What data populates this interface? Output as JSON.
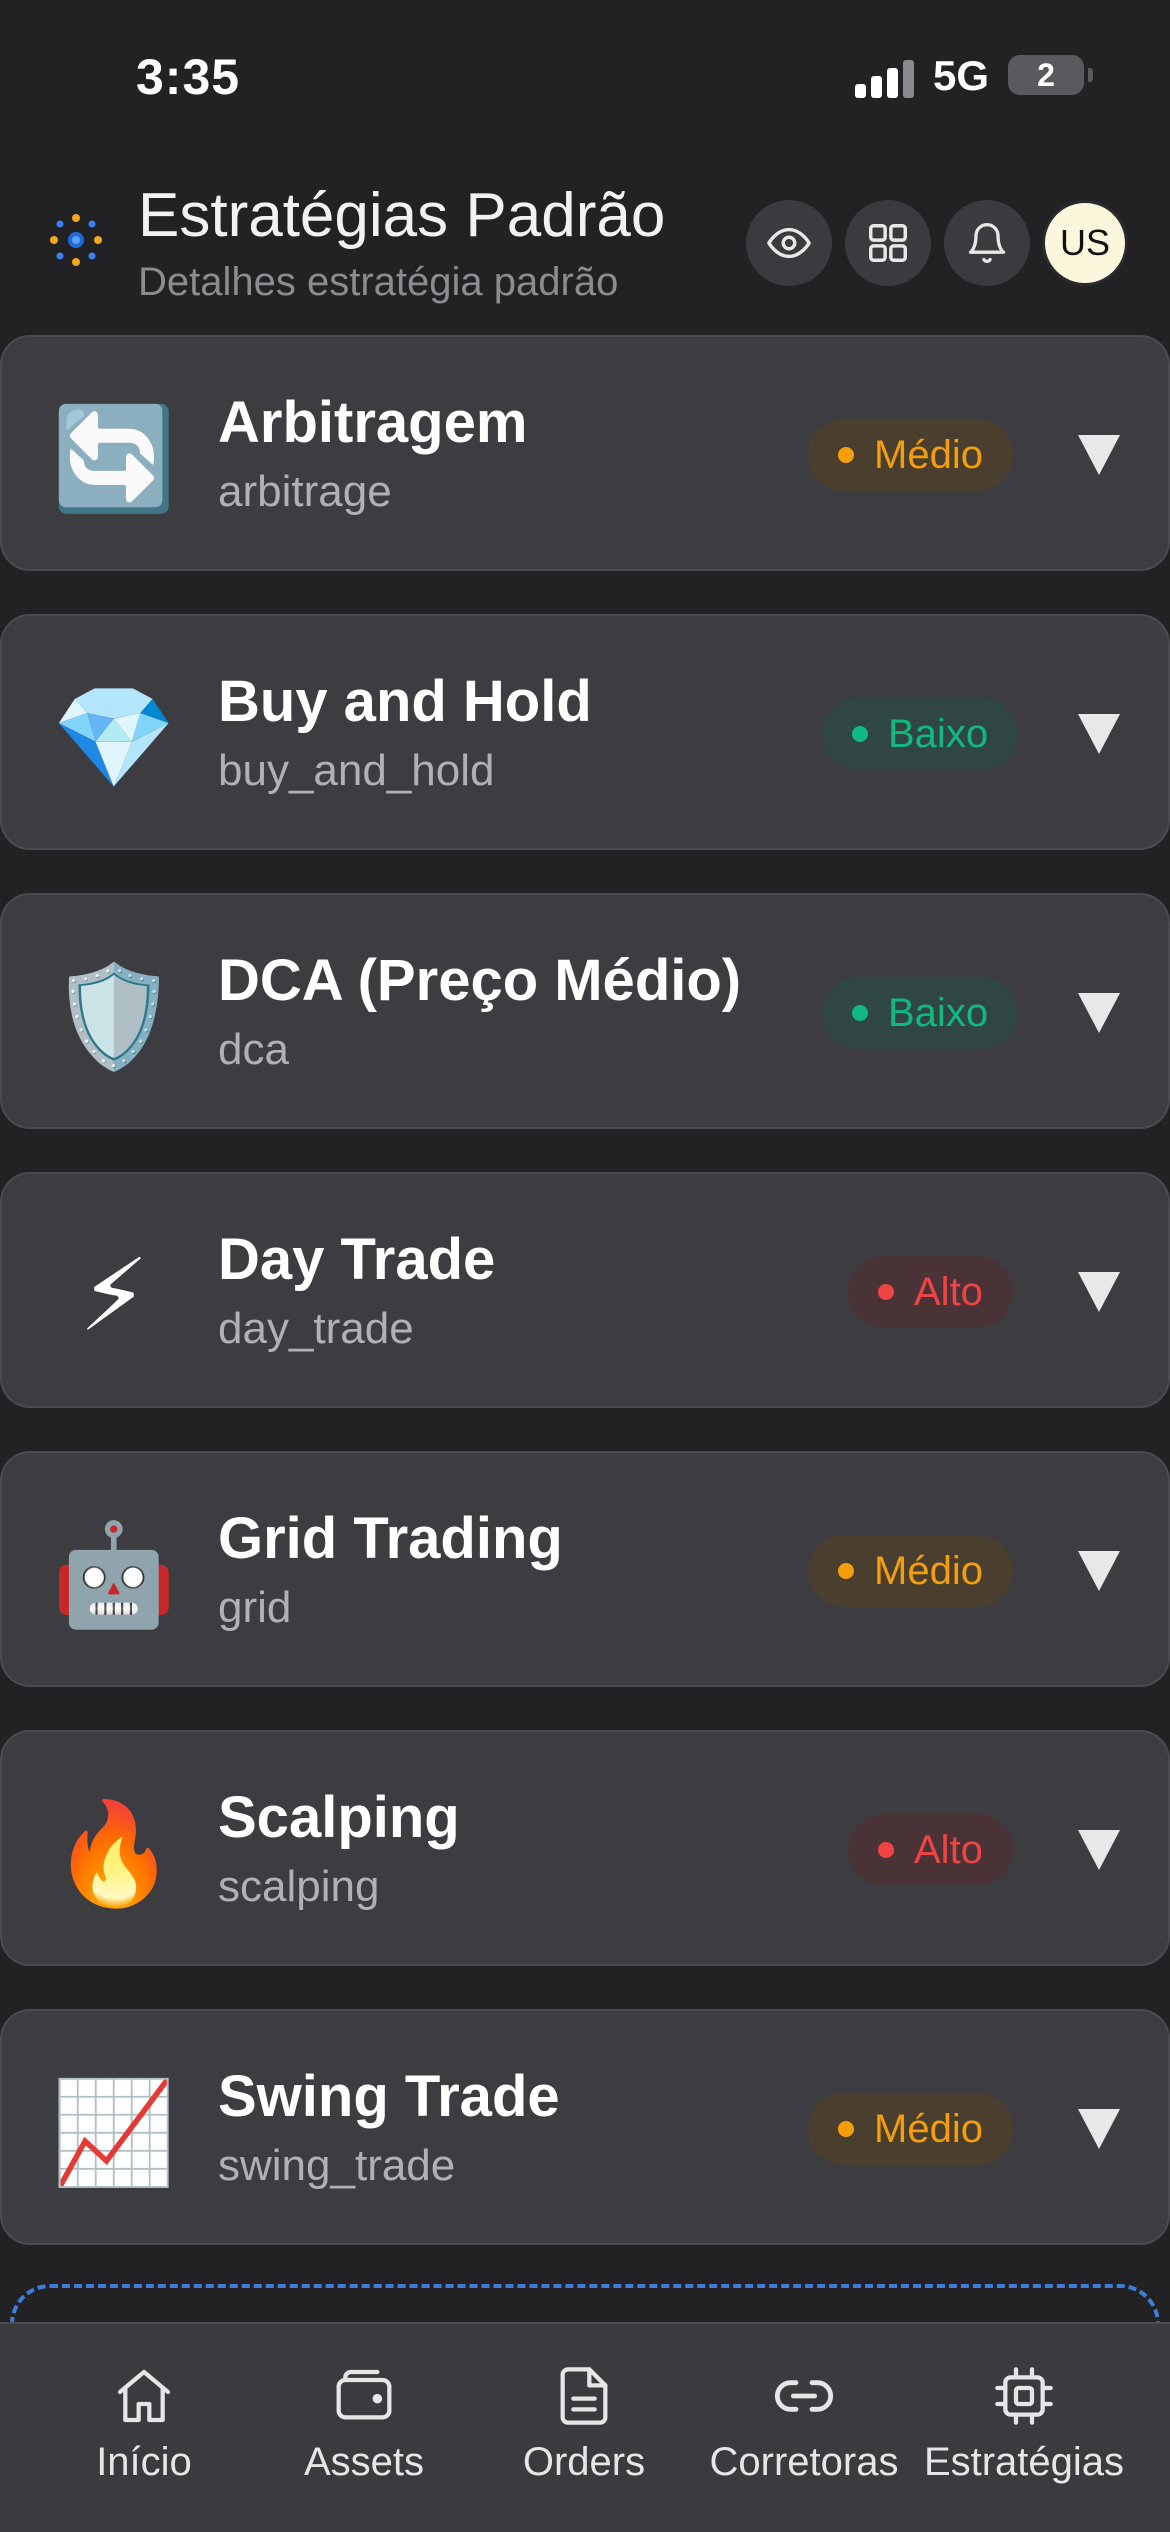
{
  "status_bar": {
    "time": "3:35",
    "network": "5G",
    "battery": "2"
  },
  "header": {
    "title": "Estratégias Padrão",
    "subtitle": "Detalhes estratégia padrão",
    "avatar_initials": "US",
    "icons": [
      "eye-icon",
      "grid-icon",
      "bell-icon"
    ]
  },
  "colors": {
    "medium": "#f59e0b",
    "low": "#10b981",
    "high": "#ef4444",
    "accent": "#3b7dd8"
  },
  "strategies": [
    {
      "name": "Arbitragem",
      "key": "arbitrage",
      "risk": "Médio",
      "risk_level": "medium",
      "emoji": "🔄"
    },
    {
      "name": "Buy and Hold",
      "key": "buy_and_hold",
      "risk": "Baixo",
      "risk_level": "low",
      "emoji": "💎"
    },
    {
      "name": "DCA (Preço Médio)",
      "key": "dca",
      "risk": "Baixo",
      "risk_level": "low",
      "emoji": "🛡️"
    },
    {
      "name": "Day Trade",
      "key": "day_trade",
      "risk": "Alto",
      "risk_level": "high",
      "emoji": "⚡"
    },
    {
      "name": "Grid Trading",
      "key": "grid",
      "risk": "Médio",
      "risk_level": "medium",
      "emoji": "🤖"
    },
    {
      "name": "Scalping",
      "key": "scalping",
      "risk": "Alto",
      "risk_level": "high",
      "emoji": "🔥"
    },
    {
      "name": "Swing Trade",
      "key": "swing_trade",
      "risk": "Médio",
      "risk_level": "medium",
      "emoji": "📈"
    }
  ],
  "tabs": [
    {
      "label": "Início",
      "icon": "home-icon"
    },
    {
      "label": "Assets",
      "icon": "wallet-icon"
    },
    {
      "label": "Orders",
      "icon": "document-icon"
    },
    {
      "label": "Corretoras",
      "icon": "link-icon"
    },
    {
      "label": "Estratégias",
      "icon": "chip-icon"
    }
  ]
}
